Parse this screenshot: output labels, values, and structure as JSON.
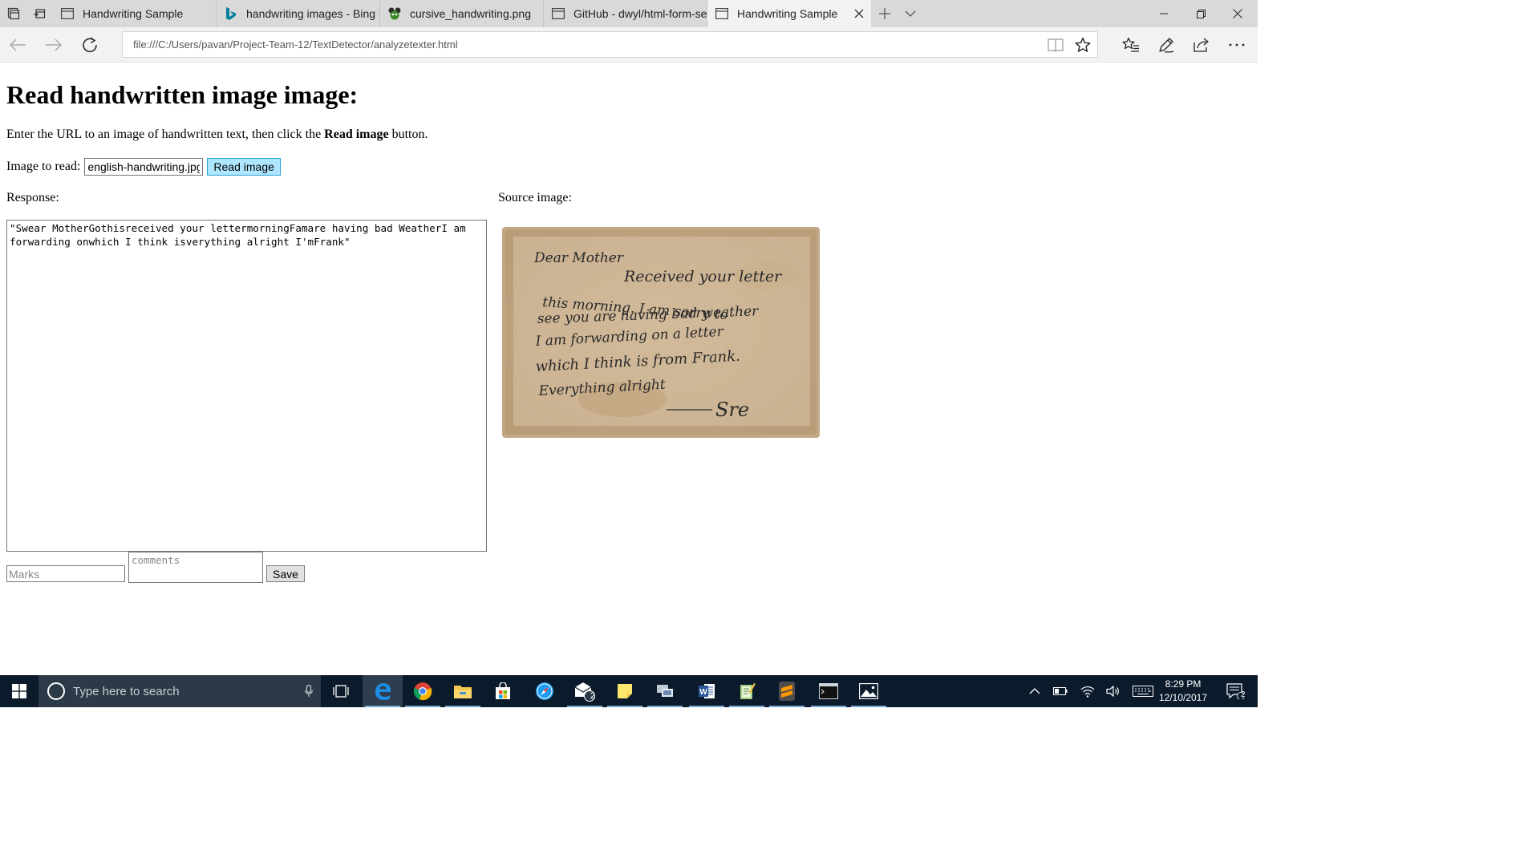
{
  "browser": {
    "tabs": [
      {
        "title": "Handwriting Sample",
        "favicon": "page-icon",
        "active": false
      },
      {
        "title": "handwriting images - Bing i",
        "favicon": "bing-icon",
        "active": false
      },
      {
        "title": "cursive_handwriting.png",
        "favicon": "image-icon",
        "active": false
      },
      {
        "title": "GitHub - dwyl/html-form-se",
        "favicon": "page-icon",
        "active": false
      },
      {
        "title": "Handwriting Sample",
        "favicon": "page-icon",
        "active": true
      }
    ],
    "address": "file:///C:/Users/pavan/Project-Team-12/TextDetector/analyzetexter.html",
    "colors": {
      "tabbar": "#d9d9d9",
      "toolbar": "#f2f2f2"
    }
  },
  "page": {
    "heading": "Read handwritten image image:",
    "intro_before": "Enter the URL to an image of handwritten text, then click the ",
    "intro_bold": "Read image",
    "intro_after": " button.",
    "image_label": "Image to read:",
    "image_value": "english-handwriting.jpg",
    "read_button": "Read image",
    "response_label": "Response:",
    "source_label": "Source image:",
    "response_text": "\"Swear MotherGothisreceived your lettermorningFamare having bad WeatherI am forwarding onwhich I think isverything alright I'mFrank\"",
    "marks_placeholder": "Marks",
    "comments_placeholder": "comments",
    "save_button": "Save",
    "handwriting": {
      "line1": "Dear Mother",
      "line2": "Received your letter",
      "line3": "this morning. I am sorry to",
      "line4": "see you are having bad weather",
      "line5": "I am forwarding on a letter",
      "line6": "which I think is from Frank.",
      "line7": "Everything alright",
      "signature": "Sre"
    },
    "colors": {
      "read_button_bg": "#aee6ff",
      "read_button_border": "#27a3d6",
      "postcard": "#d8c3a5",
      "ink": "#2a2a2a"
    }
  },
  "taskbar": {
    "search_placeholder": "Type here to search",
    "apps": [
      "task-view-icon",
      "edge-icon",
      "chrome-icon",
      "file-explorer-icon",
      "store-icon",
      "safari-icon",
      "mail-icon",
      "sticky-notes-icon",
      "network-icon",
      "word-icon",
      "notepad-icon",
      "sublime-icon",
      "terminal-icon",
      "photos-icon"
    ],
    "mail_badge": "2",
    "time": "8:29 PM",
    "date": "12/10/2017",
    "notification_count": "2",
    "colors": {
      "bar": "#0c1b2c",
      "search": "#2c3947"
    }
  }
}
